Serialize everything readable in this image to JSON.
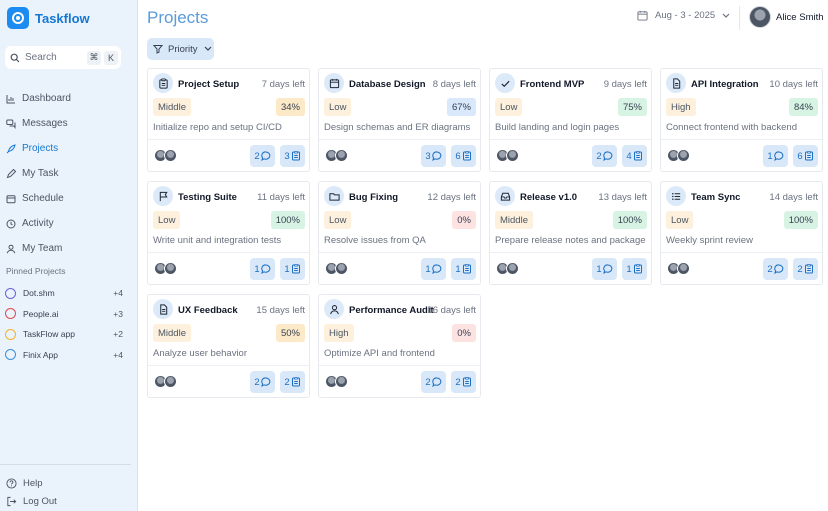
{
  "app": {
    "name": "Taskflow"
  },
  "search": {
    "placeholder": "Search",
    "kbd1": "⌘",
    "kbd2": "K"
  },
  "nav": [
    {
      "label": "Dashboard",
      "icon": "chart-icon",
      "active": false
    },
    {
      "label": "Messages",
      "icon": "messages-icon",
      "active": false
    },
    {
      "label": "Projects",
      "icon": "rocket-icon",
      "active": true
    },
    {
      "label": "My Task",
      "icon": "pencil-icon",
      "active": false
    },
    {
      "label": "Schedule",
      "icon": "calendar-icon",
      "active": false
    },
    {
      "label": "Activity",
      "icon": "activity-icon",
      "active": false
    },
    {
      "label": "My Team",
      "icon": "user-icon",
      "active": false
    }
  ],
  "pinned": {
    "title": "Pinned Projects",
    "items": [
      {
        "label": "Dot.shm",
        "count": "+4",
        "color": "#6b63d8"
      },
      {
        "label": "People.ai",
        "count": "+3",
        "color": "#e5484d"
      },
      {
        "label": "TaskFlow app",
        "count": "+2",
        "color": "#f0b429"
      },
      {
        "label": "Finix App",
        "count": "+4",
        "color": "#3b8fd9"
      }
    ]
  },
  "footer": {
    "help": "Help",
    "logout": "Log Out"
  },
  "header": {
    "title": "Projects",
    "date": "Aug - 3 - 2025",
    "user_name": "Alice Smith",
    "filter_label": "Priority"
  },
  "projects": [
    {
      "name": "Project Setup",
      "days": "7 days left",
      "priority": "Middle",
      "progress": "34%",
      "pct_tone": "amber",
      "desc": "Initialize repo and setup CI/CD",
      "comments": "2",
      "files": "3",
      "icon": "clipboard-icon"
    },
    {
      "name": "Database Design",
      "days": "8 days left",
      "priority": "Low",
      "progress": "67%",
      "pct_tone": "blue",
      "desc": "Design schemas and ER diagrams",
      "comments": "3",
      "files": "6",
      "icon": "calendar-icon"
    },
    {
      "name": "Frontend MVP",
      "days": "9 days left",
      "priority": "Low",
      "progress": "75%",
      "pct_tone": "green",
      "desc": "Build landing and login pages",
      "comments": "2",
      "files": "4",
      "icon": "check-icon"
    },
    {
      "name": "API Integration",
      "days": "10 days left",
      "priority": "High",
      "progress": "84%",
      "pct_tone": "green",
      "desc": "Connect frontend with backend",
      "comments": "1",
      "files": "6",
      "icon": "document-icon"
    },
    {
      "name": "Testing Suite",
      "days": "11 days left",
      "priority": "Low",
      "progress": "100%",
      "pct_tone": "green",
      "desc": "Write unit and integration tests",
      "comments": "1",
      "files": "1",
      "icon": "flag-icon"
    },
    {
      "name": "Bug Fixing",
      "days": "12 days left",
      "priority": "Low",
      "progress": "0%",
      "pct_tone": "red",
      "desc": "Resolve issues from QA",
      "comments": "1",
      "files": "1",
      "icon": "folder-icon"
    },
    {
      "name": "Release v1.0",
      "days": "13 days left",
      "priority": "Middle",
      "progress": "100%",
      "pct_tone": "green",
      "desc": "Prepare release notes and package",
      "comments": "1",
      "files": "1",
      "icon": "inbox-icon"
    },
    {
      "name": "Team Sync",
      "days": "14 days left",
      "priority": "Low",
      "progress": "100%",
      "pct_tone": "green",
      "desc": "Weekly sprint review",
      "comments": "2",
      "files": "2",
      "icon": "list-icon"
    },
    {
      "name": "UX Feedback",
      "days": "15 days left",
      "priority": "Middle",
      "progress": "50%",
      "pct_tone": "amber",
      "desc": "Analyze user behavior",
      "comments": "2",
      "files": "2",
      "icon": "document-icon"
    },
    {
      "name": "Performance Audit",
      "days": "16 days left",
      "priority": "High",
      "progress": "0%",
      "pct_tone": "red",
      "desc": "Optimize API and frontend",
      "comments": "2",
      "files": "2",
      "icon": "user-icon"
    }
  ]
}
